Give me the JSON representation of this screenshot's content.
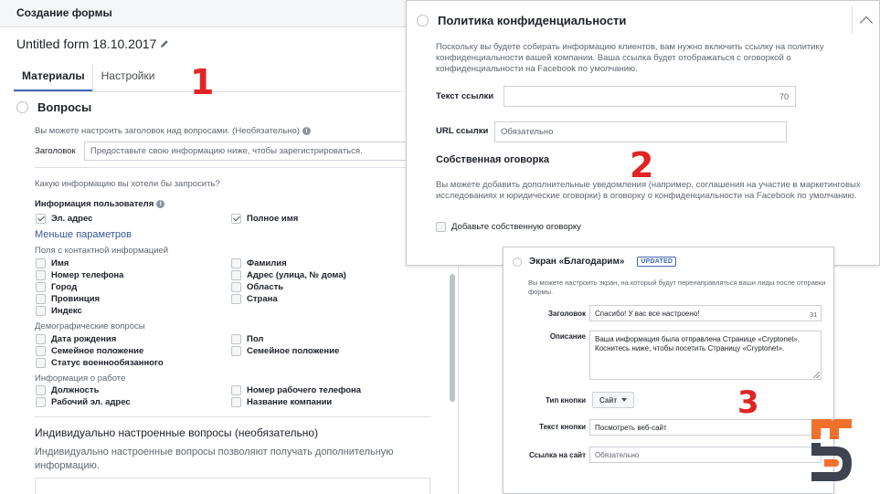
{
  "panel1": {
    "header": "Создание формы",
    "form_title": "Untitled form 18.10.2017",
    "tabs": [
      {
        "label": "Материалы",
        "active": true
      },
      {
        "label": "Настройки",
        "active": false
      }
    ],
    "annotation_number": "1",
    "questions": {
      "title": "Вопросы",
      "headline_hint": "Вы можете настроить заголовок над вопросами. (Необязательно)",
      "headline_label": "Заголовок",
      "headline_value": "Предоставьте свою информацию ниже, чтобы зарегистрироваться.",
      "ask_prompt": "Какую информацию вы хотели бы запросить?",
      "user_info_label": "Информация пользователя",
      "checked_fields": [
        {
          "label": "Эл. адрес",
          "checked": true
        },
        {
          "label": "Полное имя",
          "checked": true
        }
      ],
      "fewer_params_link": "Меньше параметров",
      "contact_group": "Поля с контактной информацией",
      "contact_fields": [
        "Имя",
        "Фамилия",
        "Номер телефона",
        "Адрес (улица, № дома)",
        "Город",
        "Область",
        "Провинция",
        "Страна",
        "Индекс"
      ],
      "demographic_group": "Демографические вопросы",
      "demographic_fields": [
        "Дата рождения",
        "Пол",
        "Семейное положение",
        "Семейное положение",
        "Статус военнообязанного"
      ],
      "work_group": "Информация о работе",
      "work_fields": [
        "Должность",
        "Номер рабочего телефона",
        "Рабочий эл. адрес",
        "Название компании"
      ]
    },
    "custom_questions": {
      "title": "Индивидуально настроенные вопросы (необязательно)",
      "description": "Индивидуально настроенные вопросы позволяют получать дополнительную информацию."
    }
  },
  "panel2": {
    "title": "Политика конфиденциальности",
    "description": "Поскольку вы будете собирать информацию клиентов, вам нужно включить ссылку на политику конфиденциальности вашей компании. Ваша ссылка будет отображаться с оговоркой о конфиденциальности на Facebook по умолчанию.",
    "link_text_label": "Текст ссылки",
    "link_text_value": "",
    "link_text_counter": "70",
    "url_label": "URL ссылки",
    "url_placeholder": "Обязательно",
    "annotation_number": "2",
    "custom_disclaimer_title": "Собственная оговорка",
    "custom_disclaimer_desc": "Вы можете добавить дополнительные уведомления (например, соглашения на участие в маркетинговых исследованиях и юридические оговорки) в оговорку о конфиденциальности на Facebook по умолчанию.",
    "add_disclaimer_label": "Добавьте собственную оговорку"
  },
  "panel3": {
    "title": "Экран «Благодарим»",
    "badge": "UPDATED",
    "description": "Вы можете настроить экран, на который будут перенаправляться ваши лиды после отправки формы.",
    "headline_label": "Заголовок",
    "headline_value": "Спасибо! У вас все настроено!",
    "headline_counter": "31",
    "description_label": "Описание",
    "description_value": "Ваша информация была отправлена Странице «Cryptonet». Коснитесь ниже, чтобы посетить Страницу «Cryptonet».",
    "button_type_label": "Тип кнопки",
    "button_type_value": "Сайт",
    "button_text_label": "Текст кнопки",
    "button_text_value": "Посмотреть веб-сайт",
    "site_link_label": "Ссылка на сайт",
    "site_link_placeholder": "Обязательно",
    "annotation_number": "3"
  },
  "colors": {
    "accent": "#4267b2",
    "annotation": "#e02424",
    "logo_orange": "#f0712c",
    "logo_dark": "#3d4450"
  }
}
